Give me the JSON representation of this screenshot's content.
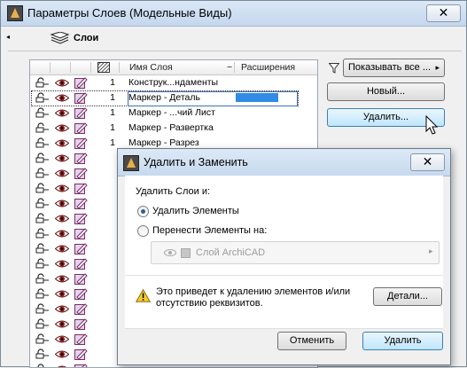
{
  "window": {
    "title": "Параметры Слоев (Модельные Виды)",
    "close_glyph": "✕"
  },
  "section": {
    "title": "Слои",
    "collapse_glyph": "◂"
  },
  "table": {
    "headers": {
      "name": "Имя Слоя",
      "ext": "Расширения",
      "sort_glyph": "−"
    },
    "rows": [
      {
        "num": "1",
        "name": "Конструк...ндаменты",
        "selected": false,
        "ext": false
      },
      {
        "num": "1",
        "name": "Маркер - Деталь",
        "selected": true,
        "ext": true
      },
      {
        "num": "1",
        "name": "Маркер - ...чий Лист",
        "selected": false,
        "ext": false
      },
      {
        "num": "1",
        "name": "Маркер - Развертка",
        "selected": false,
        "ext": false
      },
      {
        "num": "1",
        "name": "Маркер - Разрез",
        "selected": false,
        "ext": false
      },
      {
        "num": "",
        "name": "",
        "selected": false,
        "ext": false
      },
      {
        "num": "",
        "name": "",
        "selected": false,
        "ext": false
      },
      {
        "num": "",
        "name": "",
        "selected": false,
        "ext": false
      },
      {
        "num": "",
        "name": "",
        "selected": false,
        "ext": false
      },
      {
        "num": "",
        "name": "",
        "selected": false,
        "ext": false
      },
      {
        "num": "",
        "name": "",
        "selected": false,
        "ext": false
      },
      {
        "num": "",
        "name": "",
        "selected": false,
        "ext": false
      },
      {
        "num": "",
        "name": "",
        "selected": false,
        "ext": false
      },
      {
        "num": "",
        "name": "",
        "selected": false,
        "ext": false
      },
      {
        "num": "",
        "name": "",
        "selected": false,
        "ext": false
      },
      {
        "num": "",
        "name": "",
        "selected": false,
        "ext": false
      },
      {
        "num": "",
        "name": "",
        "selected": false,
        "ext": false
      },
      {
        "num": "",
        "name": "",
        "selected": false,
        "ext": false
      },
      {
        "num": "",
        "name": "",
        "selected": false,
        "ext": false
      },
      {
        "num": "",
        "name": "",
        "selected": false,
        "ext": false
      }
    ]
  },
  "right_panel": {
    "filter_label": "Показывать все ...",
    "filter_arrow": "▸",
    "new_button": "Новый...",
    "delete_button": "Удалить..."
  },
  "dialog": {
    "title": "Удалить и Заменить",
    "close_glyph": "✕",
    "prompt": "Удалить Слои и:",
    "option_delete": "Удалить Элементы",
    "option_move": "Перенести Элементы на:",
    "selected_option": "delete",
    "target_layer": "Слой ArchiCAD",
    "target_arrow": "▸",
    "warning_line1": "Это приведет к удалению элементов и/или",
    "warning_line2": "отсутствию реквизитов.",
    "details_button": "Детали...",
    "cancel_button": "Отменить",
    "confirm_button": "Удалить"
  },
  "colors": {
    "extension_bar": "#2f8be6",
    "selection_border": "#3f70b8",
    "eye": "#8b1a1a",
    "pen": "#7a2a6a"
  }
}
